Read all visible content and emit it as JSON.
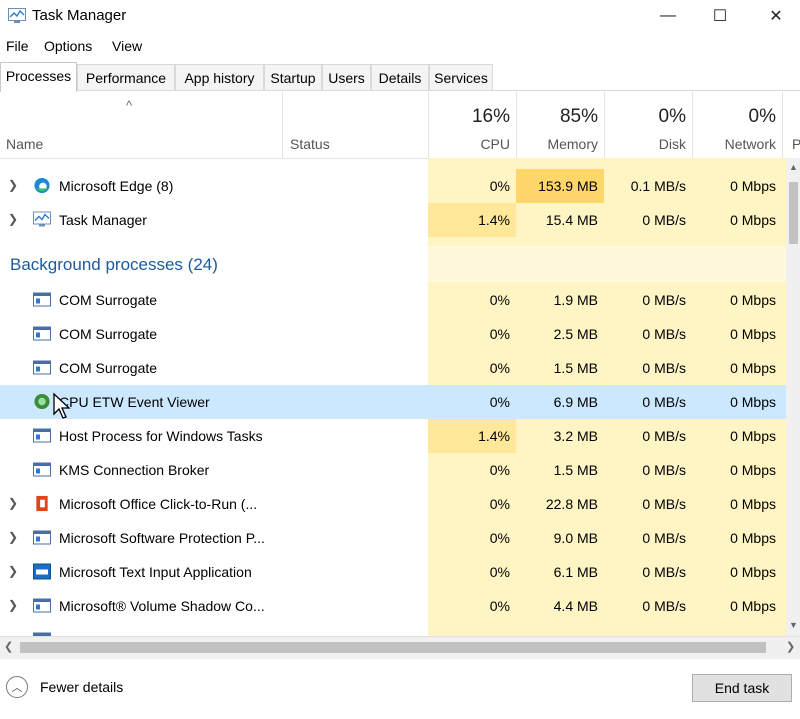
{
  "window": {
    "title": "Task Manager"
  },
  "menu": [
    "File",
    "Options",
    "View"
  ],
  "tabs": [
    "Processes",
    "Performance",
    "App history",
    "Startup",
    "Users",
    "Details",
    "Services"
  ],
  "columns": {
    "name": "Name",
    "status": "Status",
    "cpu": {
      "percent": "16%",
      "label": "CPU"
    },
    "memory": {
      "percent": "85%",
      "label": "Memory"
    },
    "disk": {
      "percent": "0%",
      "label": "Disk"
    },
    "network": {
      "percent": "0%",
      "label": "Network"
    },
    "power_partial": "P"
  },
  "apps": [
    {
      "name": "Microsoft Edge (8)",
      "cpu": "0%",
      "memory": "153.9 MB",
      "disk": "0.1 MB/s",
      "network": "0 Mbps",
      "icon": "edge-icon"
    },
    {
      "name": "Task Manager",
      "cpu": "1.4%",
      "memory": "15.4 MB",
      "disk": "0 MB/s",
      "network": "0 Mbps",
      "icon": "task-manager-icon"
    }
  ],
  "background_title": "Background processes (24)",
  "background": [
    {
      "name": "COM Surrogate",
      "cpu": "0%",
      "memory": "1.9 MB",
      "disk": "0 MB/s",
      "network": "0 Mbps"
    },
    {
      "name": "COM Surrogate",
      "cpu": "0%",
      "memory": "2.5 MB",
      "disk": "0 MB/s",
      "network": "0 Mbps"
    },
    {
      "name": "COM Surrogate",
      "cpu": "0%",
      "memory": "1.5 MB",
      "disk": "0 MB/s",
      "network": "0 Mbps"
    },
    {
      "name": "CPU ETW Event Viewer",
      "cpu": "0%",
      "memory": "6.9 MB",
      "disk": "0 MB/s",
      "network": "0 Mbps"
    },
    {
      "name": "Host Process for Windows Tasks",
      "cpu": "1.4%",
      "memory": "3.2 MB",
      "disk": "0 MB/s",
      "network": "0 Mbps"
    },
    {
      "name": "KMS Connection Broker",
      "cpu": "0%",
      "memory": "1.5 MB",
      "disk": "0 MB/s",
      "network": "0 Mbps"
    },
    {
      "name": "Microsoft Office Click-to-Run (...",
      "cpu": "0%",
      "memory": "22.8 MB",
      "disk": "0 MB/s",
      "network": "0 Mbps"
    },
    {
      "name": "Microsoft Software Protection P...",
      "cpu": "0%",
      "memory": "9.0 MB",
      "disk": "0 MB/s",
      "network": "0 Mbps"
    },
    {
      "name": "Microsoft Text Input Application",
      "cpu": "0%",
      "memory": "6.1 MB",
      "disk": "0 MB/s",
      "network": "0 Mbps"
    },
    {
      "name": "Microsoft® Volume Shadow Co...",
      "cpu": "0%",
      "memory": "4.4 MB",
      "disk": "0 MB/s",
      "network": "0 Mbps"
    }
  ],
  "footer": {
    "fewer_details": "Fewer details",
    "end_task": "End task"
  },
  "colors": {
    "heat_light": "#fff4c4",
    "heat_mid": "#ffe89a",
    "heat_strong": "#ffd66a",
    "selected": "#cce8ff",
    "section": "#1c5a9e"
  }
}
